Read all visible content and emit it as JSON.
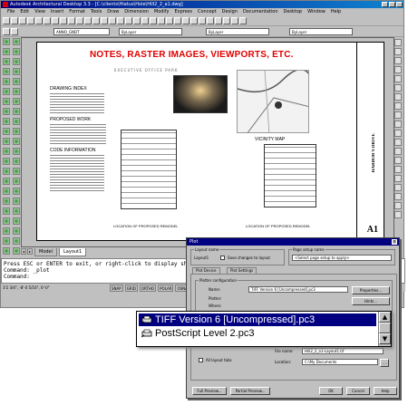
{
  "app": {
    "title": "Autodesk Architectural Desktop 3.3 - [C:\\clients\\Hiatus\\Hole\\Hill2_2_a1.dwg]",
    "menu": [
      "File",
      "Edit",
      "View",
      "Insert",
      "Format",
      "Tools",
      "Draw",
      "Dimension",
      "Modify",
      "Express",
      "Concept",
      "Design",
      "Documentation",
      "Desktop",
      "Window",
      "Help"
    ],
    "layer_combo": "ANNO_GNDT",
    "color_combo": "ByLayer",
    "linetype_combo": "ByLayer",
    "lineweight_combo": "ByLayer"
  },
  "drawing": {
    "heading": "NOTES, RASTER IMAGES, VIEWPORTS, ETC.",
    "subheading": "EXECUTIVE OFFICE PARK",
    "drawing_index": "DRAWING INDEX",
    "proposed_work": "PROPOSED WORK",
    "code_information": "CODE INFORMATION",
    "vicinity_map": "VICINITY MAP",
    "remodel_label_left": "LOCATION OF PROPOSED REMODEL",
    "remodel_label_right": "LOCATION OF PROPOSED REMODEL",
    "sheet_number": "A1",
    "titleblock_text": "HARBOR'S DRIVE"
  },
  "layout_tabs": {
    "model": "Model",
    "layout1": "Layout1"
  },
  "command_line": {
    "lines": [
      "Press ESC or ENTER to exit, or right-click to display shortcu",
      "Command: _plot",
      "Command:"
    ]
  },
  "status": {
    "coords": "3'2 3/4\", -8'-0 5/16\", 0'-0\"",
    "modes": [
      "SNAP",
      "GRID",
      "ORTHO",
      "POLAR",
      "OSNAP",
      "OTRACK"
    ]
  },
  "plot_dialog": {
    "title": "Plot",
    "layout_name_label": "Layout name",
    "layout_name": "Layout1",
    "save_changes": "Save changes to layout",
    "page_setup_label": "Page setup name",
    "page_setup": "<Select page setup to apply>",
    "tab_plot_device": "Plot Device",
    "tab_plot_settings": "Plot Settings",
    "plotter_config": "Plotter configuration",
    "name_label": "Name:",
    "plotter_label": "Plotter:",
    "where_label": "Where:",
    "name_value": "TIFF Version 6 [Uncompressed].pc3",
    "properties": "Properties...",
    "hints": "Hints...",
    "file_name_label": "File name:",
    "file_name": "Hill2_2_a1-Layout1.tif",
    "location_label": "Location:",
    "location": "C:\\My Documents",
    "all_layout_tabs": "All layout tabs",
    "full_preview": "Full Preview...",
    "partial_preview": "Partial Preview...",
    "ok": "OK",
    "cancel": "Cancel",
    "help": "Help"
  },
  "plotter_dropdown": {
    "items": [
      "TIFF Version 6 [Uncompressed].pc3",
      "PostScript Level 2.pc3"
    ],
    "selected_index": 0
  },
  "colors": {
    "heading_red": "#e00000",
    "selection_blue": "#000080",
    "titlebar_blue": "#000080"
  }
}
